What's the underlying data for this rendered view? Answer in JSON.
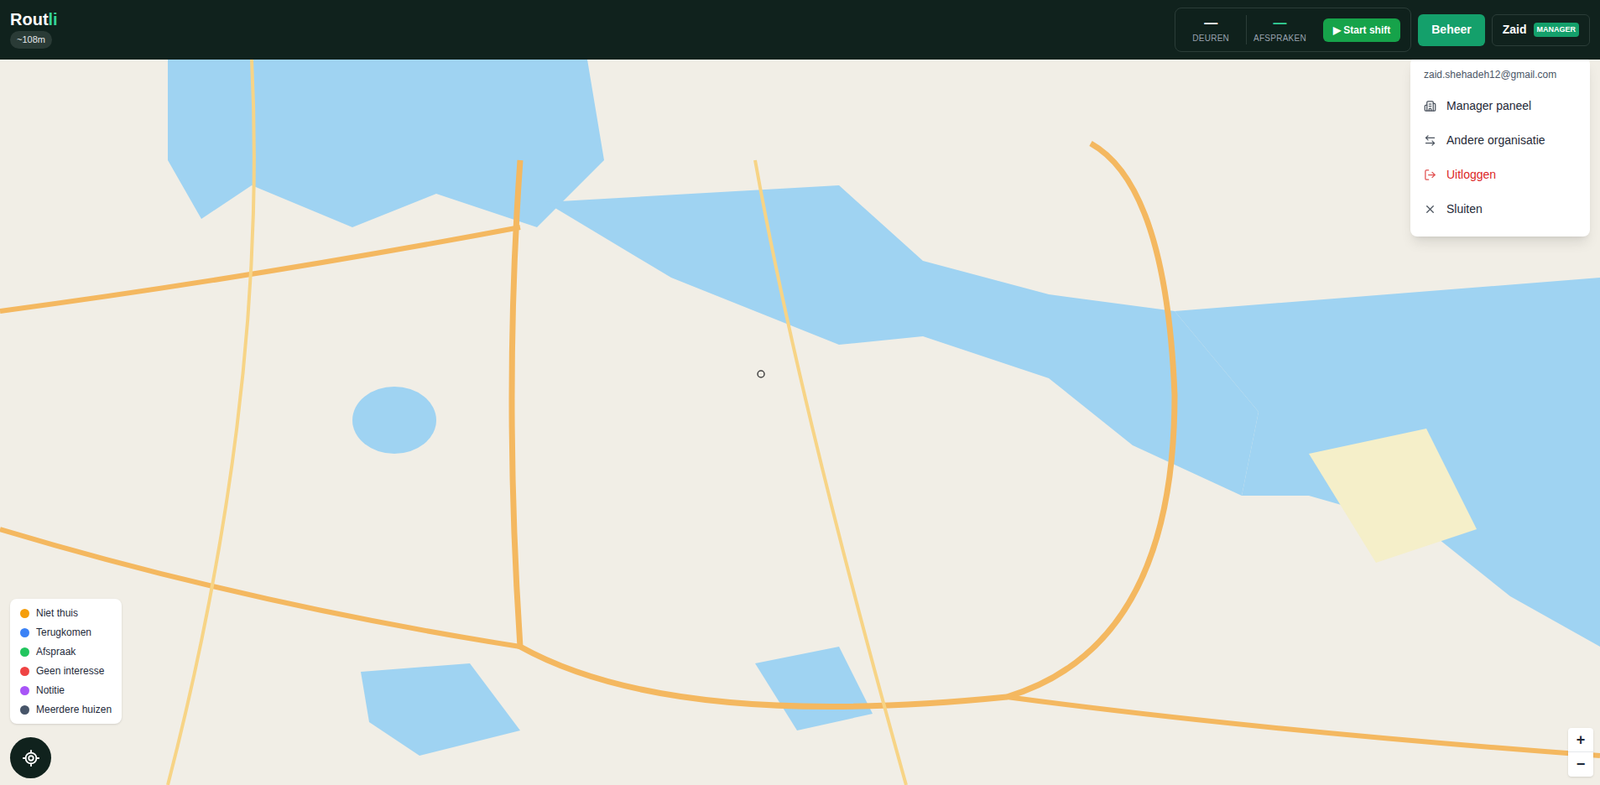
{
  "app": {
    "logo": "Rout",
    "logo_accent": "li",
    "accuracy": "~108m"
  },
  "stats": [
    {
      "value": "—",
      "label": "DEUREN",
      "color": "#ffffff"
    },
    {
      "value": "—",
      "label": "AFSPRAKEN",
      "color": "#34d399"
    }
  ],
  "start_button": "▶ Start shift",
  "admin_button": "Beheer",
  "user": {
    "name": "Zaid",
    "role": "MANAGER"
  },
  "menu": {
    "open": true,
    "email": "zaid.shehadeh12@gmail.com",
    "items": [
      {
        "label": "Manager paneel",
        "color": "#1f2937"
      },
      {
        "label": "Andere organisatie",
        "color": "#1f2937"
      },
      {
        "label": "Uitloggen",
        "color": "#dc2626"
      },
      {
        "label": "Sluiten",
        "color": "#1f2937"
      }
    ]
  },
  "legend": [
    {
      "label": "Niet thuis",
      "color": "#f59e0b"
    },
    {
      "label": "Terugkomen",
      "color": "#3b82f6"
    },
    {
      "label": "Afspraak",
      "color": "#22c55e"
    },
    {
      "label": "Geen interesse",
      "color": "#ef4444"
    },
    {
      "label": "Notitie",
      "color": "#a855f7"
    },
    {
      "label": "Meerdere huizen",
      "color": "#475569"
    }
  ],
  "zoom": {
    "in": "+",
    "out": "−"
  }
}
